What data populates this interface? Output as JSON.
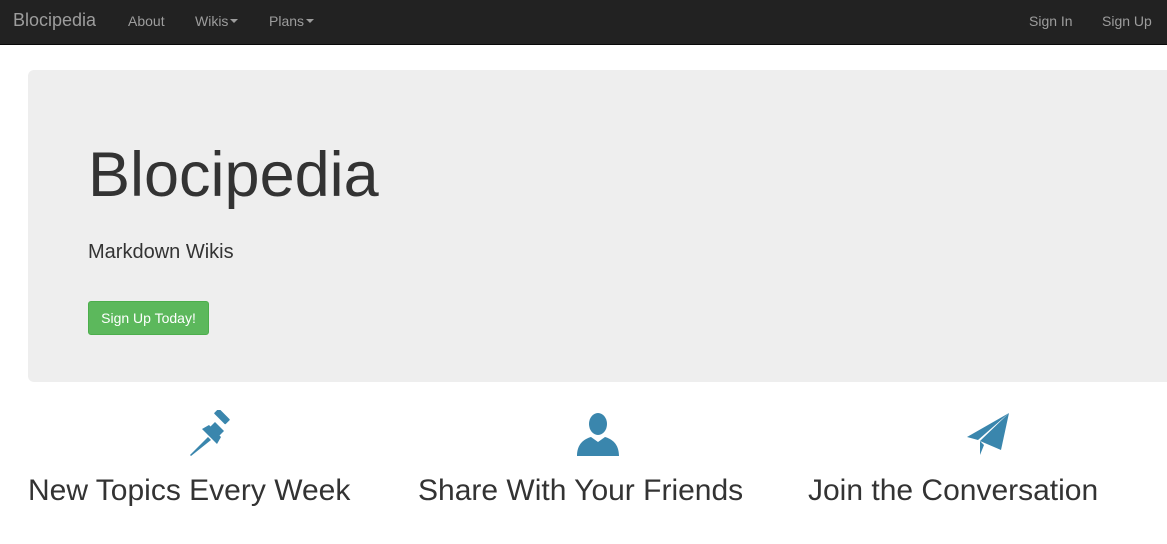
{
  "navbar": {
    "brand": "Blocipedia",
    "links": {
      "about": "About",
      "wikis": "Wikis",
      "plans": "Plans",
      "sign_in": "Sign In",
      "sign_up": "Sign Up"
    },
    "background": "#222222",
    "link_color": "#9d9d9d"
  },
  "jumbotron": {
    "title": "Blocipedia",
    "lead": "Markdown Wikis",
    "cta_label": "Sign Up Today!",
    "background": "#eeeeee",
    "cta_color": "#5cb85c"
  },
  "features": [
    {
      "icon": "pushpin-icon",
      "title": "New Topics Every Week"
    },
    {
      "icon": "user-icon",
      "title": "Share With Your Friends"
    },
    {
      "icon": "paper-plane-icon",
      "title": "Join the Conversation"
    }
  ],
  "colors": {
    "icon_accent": "#3a86ad"
  }
}
